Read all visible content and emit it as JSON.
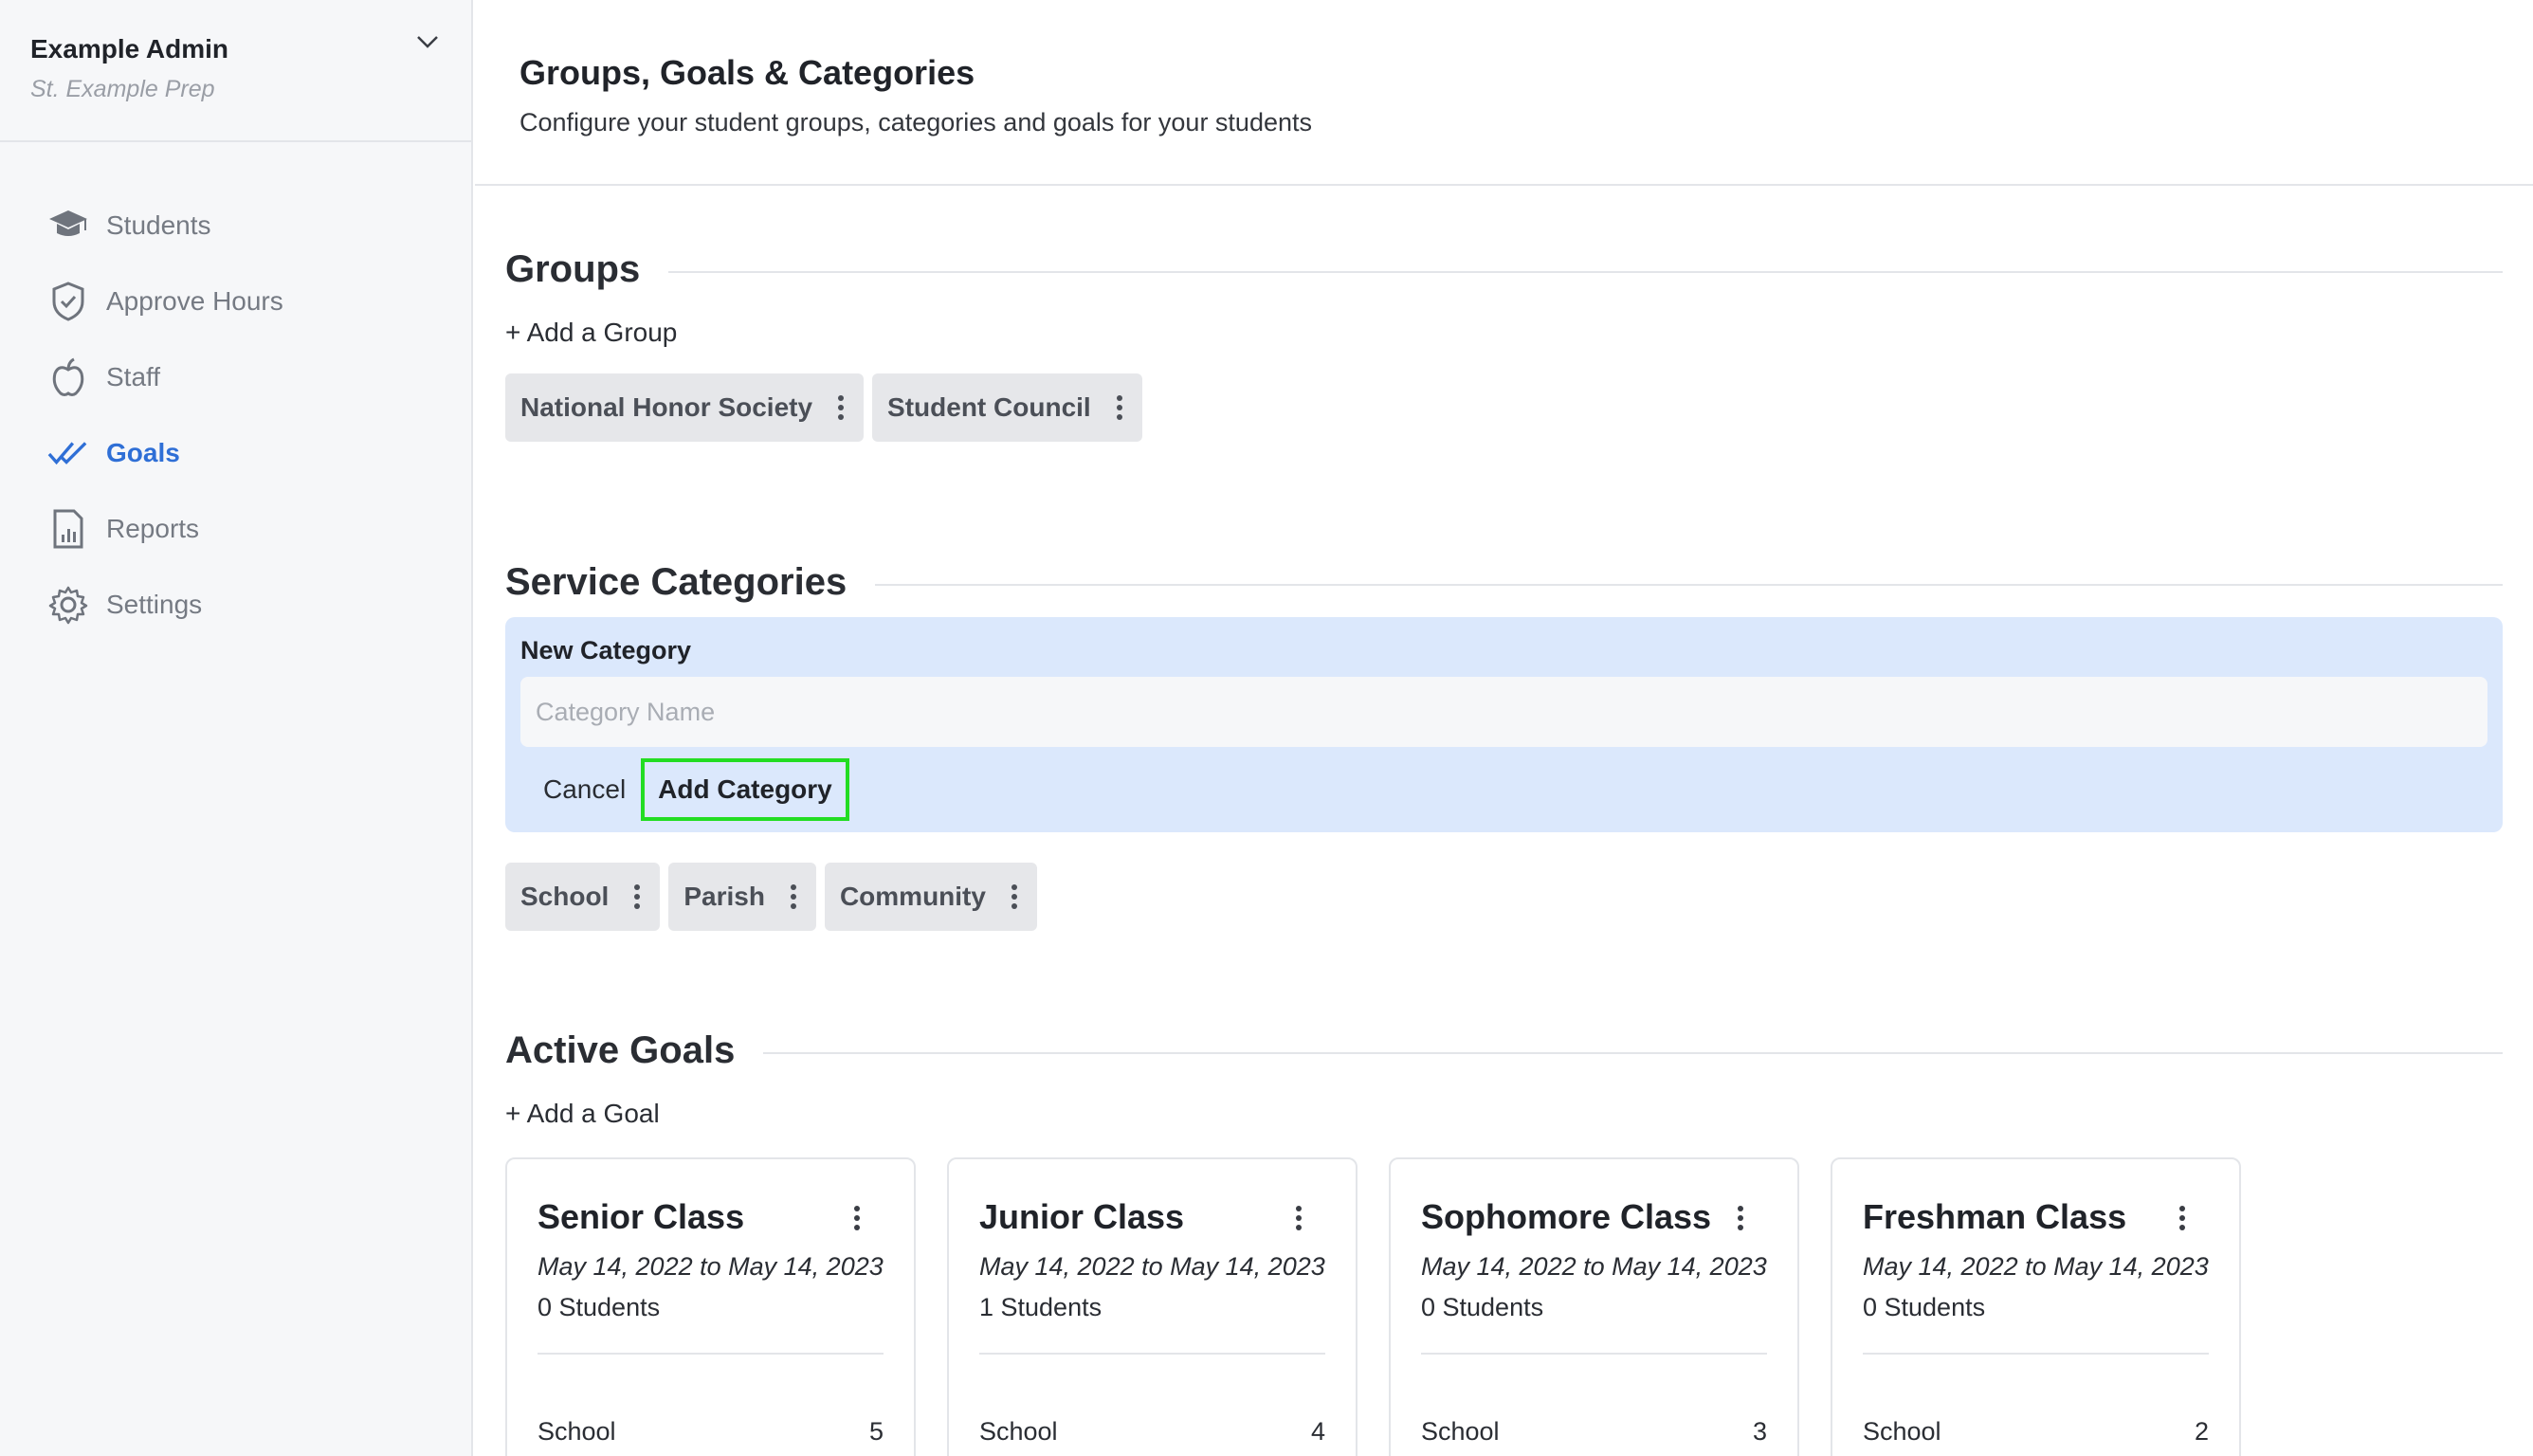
{
  "account": {
    "name": "Example Admin",
    "school": "St. Example Prep"
  },
  "sidebar": {
    "items": [
      {
        "label": "Students",
        "icon": "graduation-cap-icon"
      },
      {
        "label": "Approve Hours",
        "icon": "shield-check-icon"
      },
      {
        "label": "Staff",
        "icon": "apple-icon"
      },
      {
        "label": "Goals",
        "icon": "double-check-icon",
        "active": true
      },
      {
        "label": "Reports",
        "icon": "report-icon"
      },
      {
        "label": "Settings",
        "icon": "gear-icon"
      }
    ]
  },
  "header": {
    "title": "Groups, Goals & Categories",
    "subtitle": "Configure your student groups, categories and goals for your students"
  },
  "groups": {
    "title": "Groups",
    "add_label": "+ Add a Group",
    "items": [
      "National Honor Society",
      "Student Council"
    ]
  },
  "categories": {
    "title": "Service Categories",
    "form": {
      "label": "New Category",
      "placeholder": "Category Name",
      "value": "",
      "cancel_label": "Cancel",
      "submit_label": "Add Category"
    },
    "items": [
      "School",
      "Parish",
      "Community"
    ]
  },
  "goals": {
    "title": "Active Goals",
    "add_label": "+ Add a Goal",
    "cards": [
      {
        "title": "Senior Class",
        "dates": "May 14, 2022 to May 14, 2023",
        "students": "0 Students",
        "row_label": "School",
        "row_value": "5"
      },
      {
        "title": "Junior Class",
        "dates": "May 14, 2022 to May 14, 2023",
        "students": "1 Students",
        "row_label": "School",
        "row_value": "4"
      },
      {
        "title": "Sophomore Class",
        "dates": "May 14, 2022 to May 14, 2023",
        "students": "0 Students",
        "row_label": "School",
        "row_value": "3"
      },
      {
        "title": "Freshman Class",
        "dates": "May 14, 2022 to May 14, 2023",
        "students": "0 Students",
        "row_label": "School",
        "row_value": "2"
      }
    ]
  },
  "colors": {
    "accent": "#2f6fd6",
    "highlight": "#22dd22",
    "form_bg": "#dbe8fc",
    "chip_bg": "#e6e7ea"
  }
}
